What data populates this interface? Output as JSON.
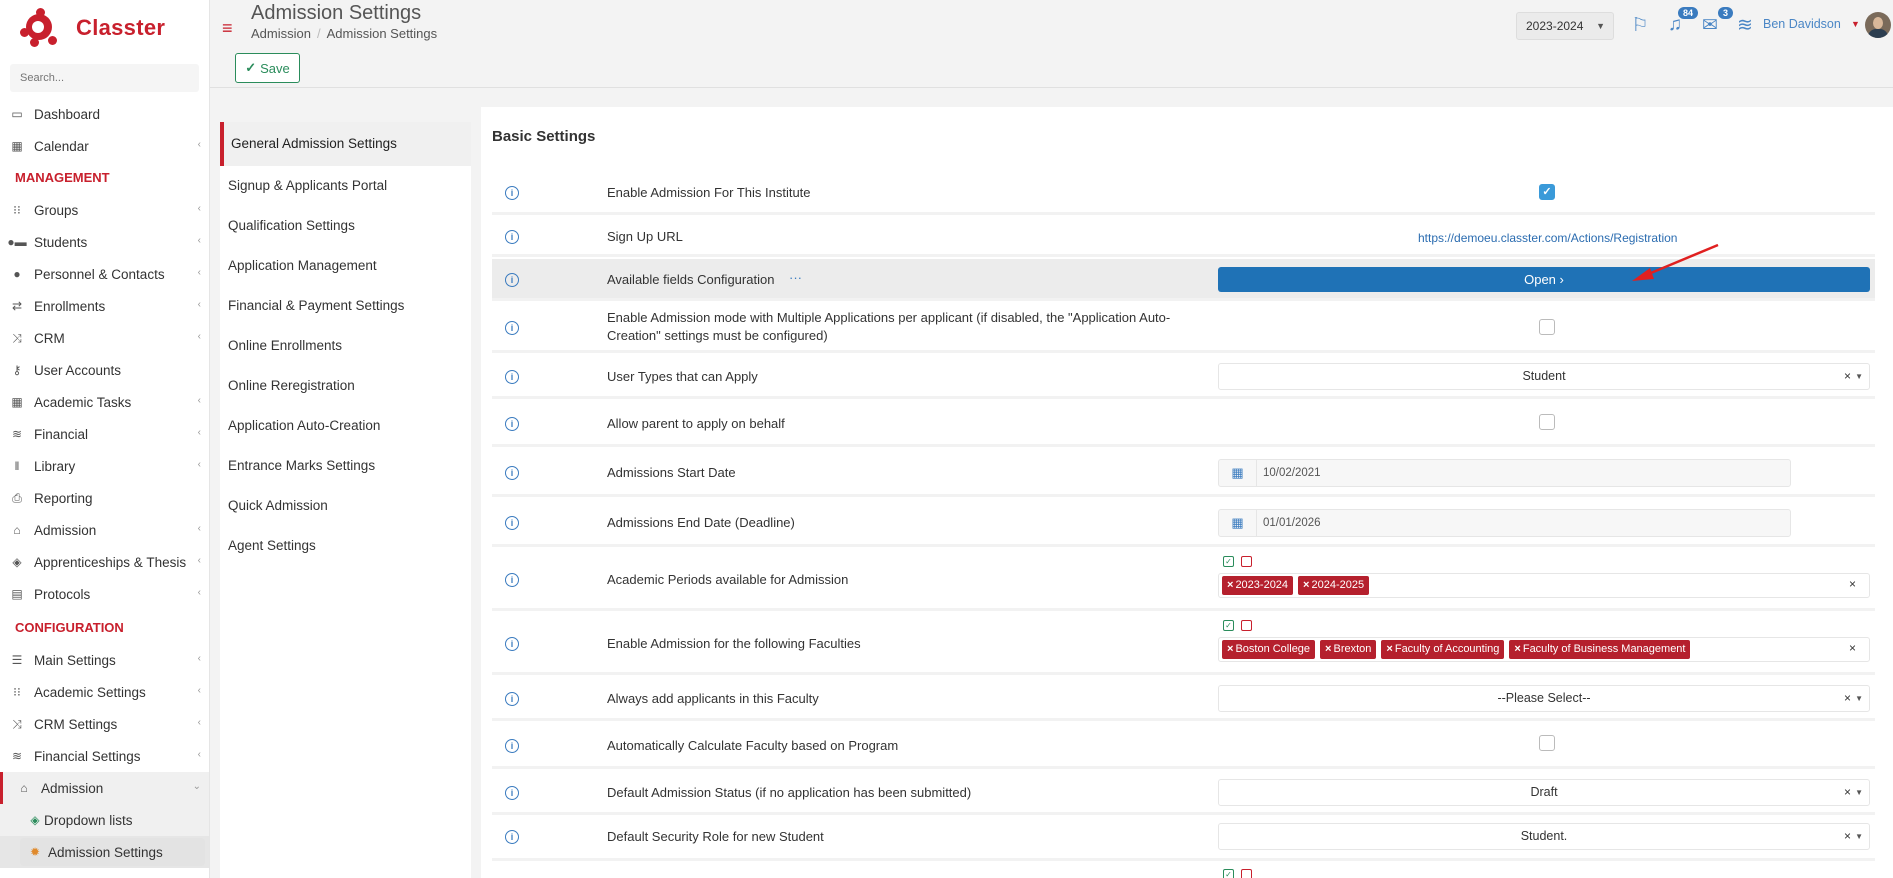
{
  "brand": {
    "name": "Classter"
  },
  "sidebar": {
    "search_placeholder": "Search...",
    "items": [
      {
        "label": "Dashboard",
        "icon": "laptop-icon"
      },
      {
        "label": "Calendar",
        "icon": "calendar-icon"
      }
    ],
    "section_management": "MANAGEMENT",
    "management": [
      {
        "label": "Groups",
        "icon": "groups-icon"
      },
      {
        "label": "Students",
        "icon": "students-icon"
      },
      {
        "label": "Personnel & Contacts",
        "icon": "person-icon"
      },
      {
        "label": "Enrollments",
        "icon": "exchange-icon"
      },
      {
        "label": "CRM",
        "icon": "crm-icon"
      },
      {
        "label": "User Accounts",
        "icon": "key-icon"
      },
      {
        "label": "Academic Tasks",
        "icon": "tasks-icon"
      },
      {
        "label": "Financial",
        "icon": "coins-icon"
      },
      {
        "label": "Library",
        "icon": "books-icon"
      },
      {
        "label": "Reporting",
        "icon": "print-icon"
      },
      {
        "label": "Admission",
        "icon": "institution-icon"
      },
      {
        "label": "Apprenticeships & Thesis",
        "icon": "cube-icon"
      },
      {
        "label": "Protocols",
        "icon": "protocols-icon"
      }
    ],
    "section_configuration": "CONFIGURATION",
    "configuration": [
      {
        "label": "Main Settings",
        "icon": "sliders-icon"
      },
      {
        "label": "Academic Settings",
        "icon": "groups-icon"
      },
      {
        "label": "CRM Settings",
        "icon": "crm-icon"
      },
      {
        "label": "Financial Settings",
        "icon": "coins-icon"
      },
      {
        "label": "Admission",
        "icon": "institution-icon"
      }
    ],
    "admission_sub": [
      {
        "label": "Dropdown lists",
        "icon": "layers-icon"
      },
      {
        "label": "Admission Settings",
        "icon": "cog-icon"
      }
    ]
  },
  "header": {
    "title": "Admission Settings",
    "breadcrumb": [
      "Admission",
      "Admission Settings"
    ],
    "save_label": "Save",
    "year": "2023-2024",
    "bell_count": "84",
    "mail_count": "3",
    "user_name": "Ben Davidson"
  },
  "subnav": [
    "General Admission Settings",
    "Signup & Applicants Portal",
    "Qualification Settings",
    "Application Management",
    "Financial & Payment Settings",
    "Online Enrollments",
    "Online Reregistration",
    "Application Auto-Creation",
    "Entrance Marks Settings",
    "Quick Admission",
    "Agent Settings"
  ],
  "main": {
    "section_title": "Basic Settings",
    "rows": {
      "enable_admission": {
        "label": "Enable Admission For This Institute",
        "checked": true
      },
      "signup_url": {
        "label": "Sign Up URL",
        "value": "https://demoeu.classter.com/Actions/Registration"
      },
      "fields_config": {
        "label": "Available fields Configuration",
        "more": "···",
        "button": "Open"
      },
      "multi_apps": {
        "label": "Enable Admission mode with Multiple Applications per applicant (if disabled, the \"Application Auto-Creation\" settings must be configured)",
        "checked": false
      },
      "user_types": {
        "label": "User Types that can Apply",
        "value": "Student"
      },
      "parent_apply": {
        "label": "Allow parent to apply on behalf",
        "checked": false
      },
      "start_date": {
        "label": "Admissions Start Date",
        "value": "10/02/2021"
      },
      "end_date": {
        "label": "Admissions End Date (Deadline)",
        "value": "01/01/2026"
      },
      "periods": {
        "label": "Academic Periods available for Admission",
        "tags": [
          "2023-2024",
          "2024-2025"
        ]
      },
      "faculties": {
        "label": "Enable Admission for the following Faculties",
        "tags": [
          "Boston College",
          "Brexton",
          "Faculty of Accounting",
          "Faculty of Business Management"
        ]
      },
      "always_faculty": {
        "label": "Always add applicants in this Faculty",
        "value": "--Please Select--"
      },
      "auto_faculty": {
        "label": "Automatically Calculate Faculty based on Program",
        "checked": false
      },
      "default_status": {
        "label": "Default Admission Status (if no application has been submitted)",
        "value": "Draft"
      },
      "security_role": {
        "label": "Default Security Role for new Student",
        "value": "Student."
      }
    }
  },
  "colors": {
    "brand_red": "#c8202d",
    "primary_blue": "#1f72b6",
    "save_green": "#2a8c5b"
  }
}
